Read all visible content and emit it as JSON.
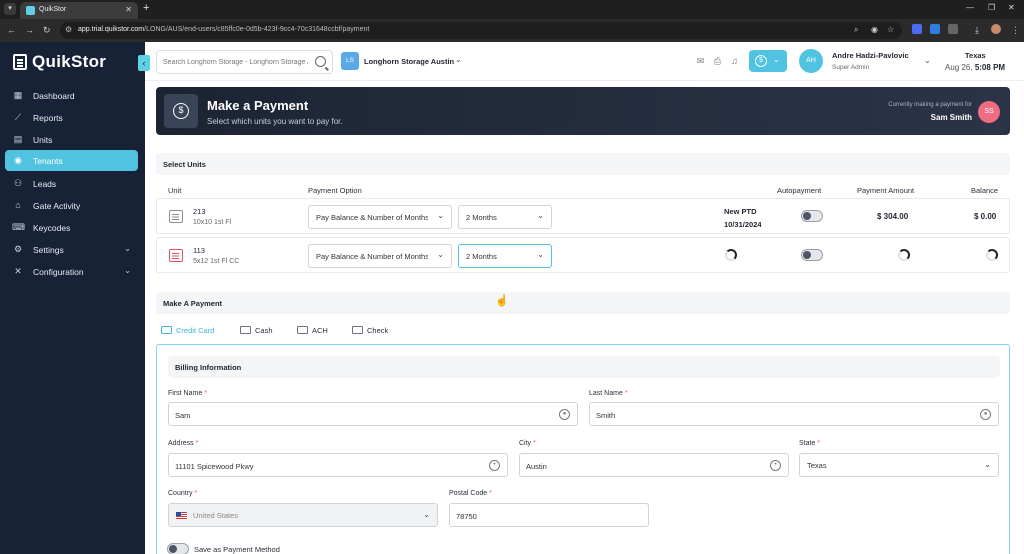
{
  "browser": {
    "tab_title": "QuikStor",
    "url_host": "app.trial.quikstor.com",
    "url_path": "/LONG/AUS/end-users/c85ffc0e-0d5b-423f-9cc4-70c31648ccbf/payment"
  },
  "sidebar": {
    "brand": "QuikStor",
    "items": [
      {
        "label": "Dashboard",
        "icon": "dashboard-icon"
      },
      {
        "label": "Reports",
        "icon": "reports-icon"
      },
      {
        "label": "Units",
        "icon": "units-icon"
      },
      {
        "label": "Tenants",
        "icon": "tenants-icon"
      },
      {
        "label": "Leads",
        "icon": "leads-icon"
      },
      {
        "label": "Gate Activity",
        "icon": "gate-icon"
      },
      {
        "label": "Keycodes",
        "icon": "keycodes-icon"
      },
      {
        "label": "Settings",
        "icon": "gear-icon"
      },
      {
        "label": "Configuration",
        "icon": "wrench-icon"
      }
    ],
    "active": "Tenants"
  },
  "header": {
    "search_placeholder": "Search Longhorn Storage - Longhorn Storage Austin",
    "facility_badge": "LS",
    "facility_name": "Longhorn Storage Austin",
    "user_initials": "AH",
    "user_name": "Andre Hadzi-Pavlovic",
    "user_role": "Super Admin",
    "timezone_state": "Texas",
    "date": "Aug 26,",
    "time": "5:08",
    "meridiem": "PM"
  },
  "banner": {
    "title": "Make a Payment",
    "subtitle": "Select which units you want to pay for.",
    "note": "Currently making a payment for",
    "tenant_name": "Sam Smith",
    "tenant_initials": "SS"
  },
  "select_units": {
    "heading": "Select Units",
    "columns": {
      "unit": "Unit",
      "option": "Payment Option",
      "autopay": "Autopayment",
      "amount": "Payment Amount",
      "balance": "Balance"
    },
    "rows": [
      {
        "unit": "213",
        "size": "10x10 1st Fl",
        "option": "Pay Balance & Number of Months",
        "months": "2 Months",
        "ptd_label": "New PTD",
        "ptd_date": "10/31/2024",
        "amount": "$ 304.00",
        "balance": "$ 0.00",
        "loading": false
      },
      {
        "unit": "113",
        "size": "5x12 1st Fl CC",
        "option": "Pay Balance & Number of Months",
        "months": "2 Months",
        "loading": true
      }
    ]
  },
  "make_payment": {
    "heading": "Make A Payment",
    "tabs": [
      "Credit Card",
      "Cash",
      "ACH",
      "Check"
    ],
    "active_tab": "Credit Card"
  },
  "billing": {
    "heading": "Billing Information",
    "first_name_label": "First Name",
    "first_name": "Sam",
    "last_name_label": "Last Name",
    "last_name": "Smith",
    "address_label": "Address",
    "address": "11101 Spicewood Pkwy",
    "city_label": "City",
    "city": "Austin",
    "state_label": "State",
    "state": "Texas",
    "country_label": "Country",
    "country": "United States",
    "postal_label": "Postal Code",
    "postal": "78750",
    "required_mark": "*",
    "save_label": "Save as Payment Method"
  },
  "colors": {
    "accent": "#4fc3e0",
    "sidebar_bg": "#172237",
    "banner_bg": "#1c2434",
    "tenant_avatar": "#f06c82"
  }
}
